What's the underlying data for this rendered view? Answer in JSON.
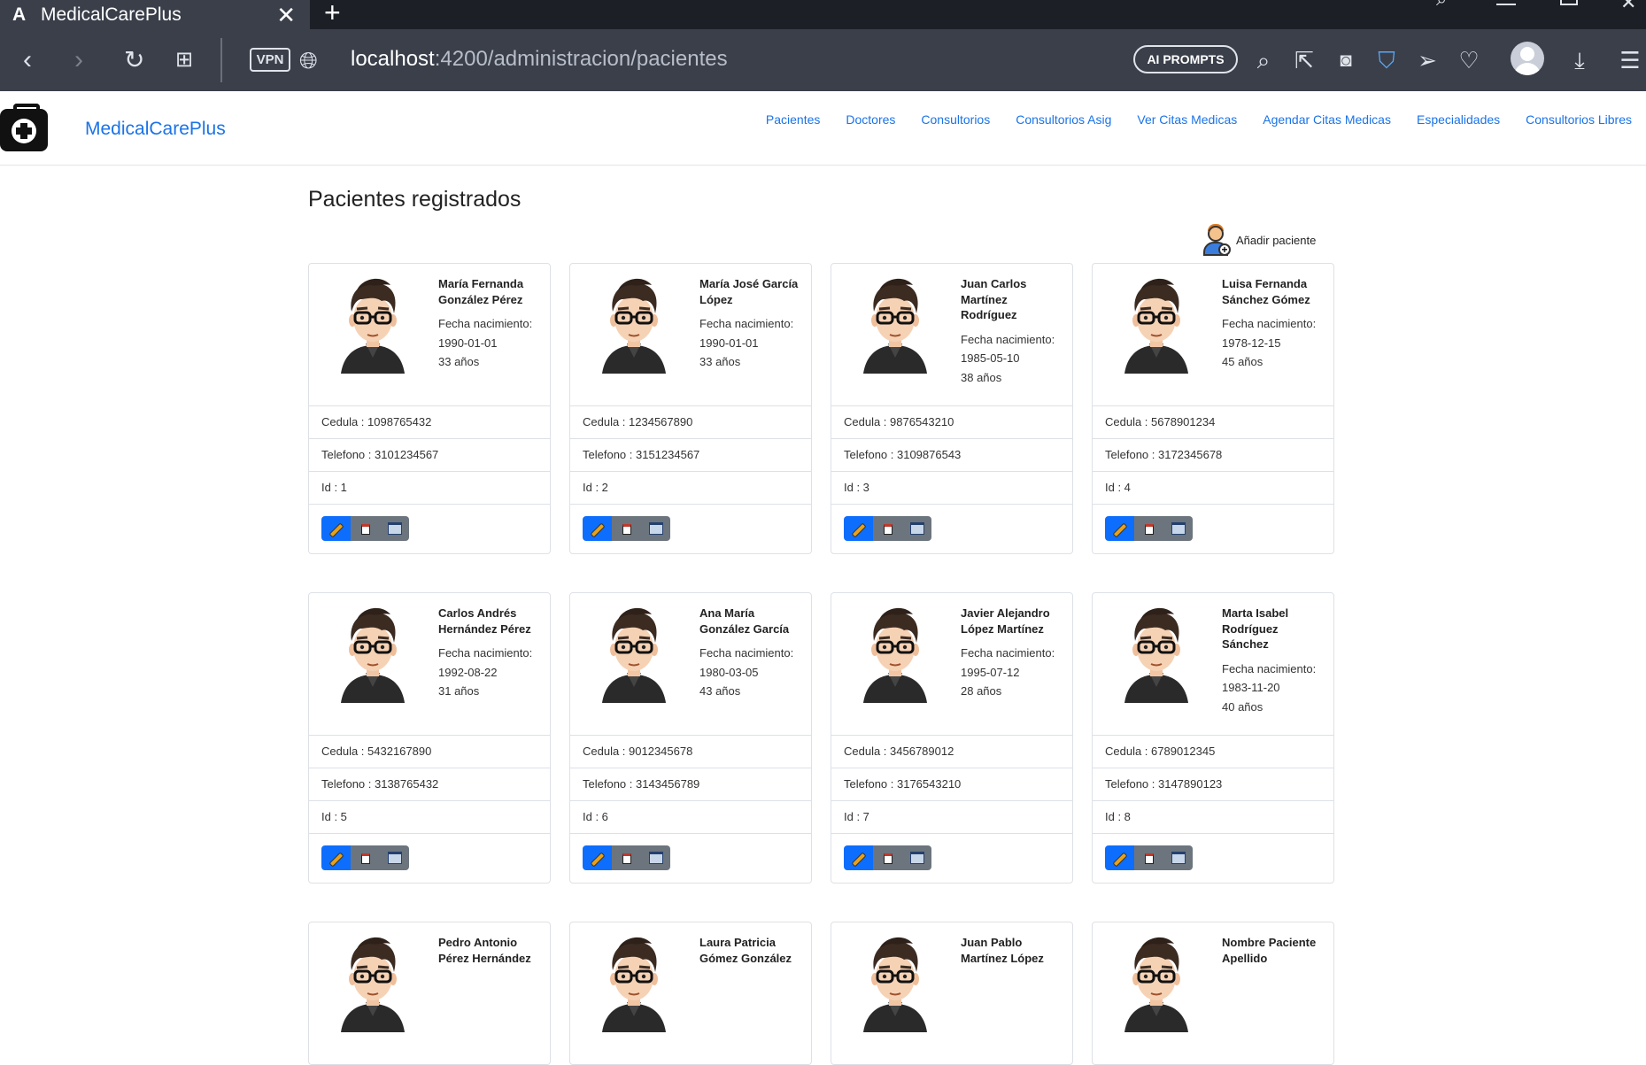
{
  "browser": {
    "tab_title": "MedicalCarePlus",
    "url_host": "localhost",
    "url_path": ":4200/administracion/pacientes",
    "vpn_label": "VPN",
    "ai_prompts_label": "AI PROMPTS"
  },
  "navbar": {
    "brand": "MedicalCarePlus",
    "links": [
      "Pacientes",
      "Doctores",
      "Consultorios",
      "Consultorios Asig",
      "Ver Citas Medicas",
      "Agendar Citas Medicas",
      "Especialidades",
      "Consultorios Libres"
    ]
  },
  "page": {
    "title": "Pacientes registrados",
    "add_patient_label": "Añadir paciente"
  },
  "patients": [
    {
      "name": "María Fernanda González Pérez",
      "dob_label": "Fecha nacimiento:",
      "dob": "1990-01-01",
      "age": "33 años",
      "cedula": "Cedula : 1098765432",
      "telefono": "Telefono : 3101234567",
      "id": "Id : 1"
    },
    {
      "name": "María José García López",
      "dob_label": "Fecha nacimiento:",
      "dob": "1990-01-01",
      "age": "33 años",
      "cedula": "Cedula : 1234567890",
      "telefono": "Telefono : 3151234567",
      "id": "Id : 2"
    },
    {
      "name": "Juan Carlos Martínez Rodríguez",
      "dob_label": "Fecha nacimiento:",
      "dob": "1985-05-10",
      "age": "38 años",
      "cedula": "Cedula : 9876543210",
      "telefono": "Telefono : 3109876543",
      "id": "Id : 3"
    },
    {
      "name": "Luisa Fernanda Sánchez Gómez",
      "dob_label": "Fecha nacimiento:",
      "dob": "1978-12-15",
      "age": "45 años",
      "cedula": "Cedula : 5678901234",
      "telefono": "Telefono : 3172345678",
      "id": "Id : 4"
    },
    {
      "name": "Carlos Andrés Hernández Pérez",
      "dob_label": "Fecha nacimiento:",
      "dob": "1992-08-22",
      "age": "31 años",
      "cedula": "Cedula : 5432167890",
      "telefono": "Telefono : 3138765432",
      "id": "Id : 5"
    },
    {
      "name": "Ana María González García",
      "dob_label": "Fecha nacimiento:",
      "dob": "1980-03-05",
      "age": "43 años",
      "cedula": "Cedula : 9012345678",
      "telefono": "Telefono : 3143456789",
      "id": "Id : 6"
    },
    {
      "name": "Javier Alejandro López Martínez",
      "dob_label": "Fecha nacimiento:",
      "dob": "1995-07-12",
      "age": "28 años",
      "cedula": "Cedula : 3456789012",
      "telefono": "Telefono : 3176543210",
      "id": "Id : 7"
    },
    {
      "name": "Marta Isabel Rodríguez Sánchez",
      "dob_label": "Fecha nacimiento:",
      "dob": "1983-11-20",
      "age": "40 años",
      "cedula": "Cedula : 6789012345",
      "telefono": "Telefono : 3147890123",
      "id": "Id : 8"
    },
    {
      "name": "Pedro Antonio Pérez Hernández"
    },
    {
      "name": "Laura Patricia Gómez González"
    },
    {
      "name": "Juan Pablo Martínez López"
    },
    {
      "name": "Nombre Paciente Apellido"
    }
  ]
}
